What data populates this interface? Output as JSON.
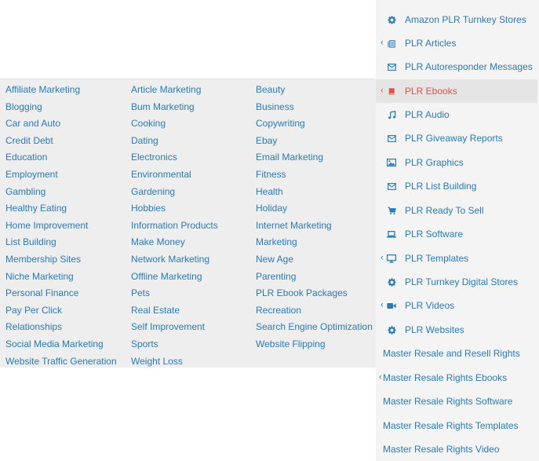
{
  "colors": {
    "link": "#2a7ab8",
    "active": "#d9534f",
    "panel": "#eeeeee",
    "sidebar": "#f4f4f4"
  },
  "sidebar": {
    "items": [
      {
        "label": "Amazon PLR Turnkey Stores",
        "icon": "gear-icon"
      },
      {
        "label": "PLR Articles",
        "icon": "articles-icon",
        "submenu": true
      },
      {
        "label": "PLR Autoresponder Messages",
        "icon": "envelope-icon"
      },
      {
        "label": "PLR Ebooks",
        "icon": "book-icon",
        "submenu": true,
        "active": true
      },
      {
        "label": "PLR Audio",
        "icon": "music-icon"
      },
      {
        "label": "PLR Giveaway Reports",
        "icon": "envelope-icon"
      },
      {
        "label": "PLR Graphics",
        "icon": "image-icon"
      },
      {
        "label": "PLR List Building",
        "icon": "envelope-icon"
      },
      {
        "label": "PLR Ready To Sell",
        "icon": "cart-icon"
      },
      {
        "label": "PLR Software",
        "icon": "laptop-icon"
      },
      {
        "label": "PLR Templates",
        "icon": "monitor-icon",
        "submenu": true
      },
      {
        "label": "PLR Turnkey Digital Stores",
        "icon": "gear-icon"
      },
      {
        "label": "PLR Videos",
        "icon": "video-icon",
        "submenu": true
      },
      {
        "label": "PLR Websites",
        "icon": "gear-icon"
      },
      {
        "label": "Master Resale and Resell Rights"
      },
      {
        "label": "Master Resale Rights Ebooks",
        "submenu": true
      },
      {
        "label": "Master Resale Rights Software"
      },
      {
        "label": "Master Resale Rights Templates"
      },
      {
        "label": "Master Resale Rights Video"
      }
    ]
  },
  "submenu": {
    "columns": [
      [
        "Affiliate Marketing",
        "Blogging",
        "Car and Auto",
        "Credit Debt",
        "Education",
        "Employment",
        "Gambling",
        "Healthy Eating",
        "Home Improvement",
        "List Building",
        "Membership Sites",
        "Niche Marketing",
        "Personal Finance",
        "Pay Per Click",
        "Relationships",
        "Social Media Marketing",
        "Website Traffic Generation"
      ],
      [
        "Article Marketing",
        "Bum Marketing",
        "Cooking",
        "Dating",
        "Electronics",
        "Environmental",
        "Gardening",
        "Hobbies",
        "Information Products",
        "Make Money",
        "Network Marketing",
        "Offline Marketing",
        "Pets",
        "Real Estate",
        "Self Improvement",
        "Sports",
        "Weight Loss"
      ],
      [
        "Beauty",
        "Business",
        "Copywriting",
        "Ebay",
        "Email Marketing",
        "Fitness",
        "Health",
        "Holiday",
        "Internet Marketing",
        "Marketing",
        "New Age",
        "Parenting",
        "PLR Ebook Packages",
        "Recreation",
        "Search Engine Optimization",
        "Website Flipping"
      ]
    ]
  }
}
